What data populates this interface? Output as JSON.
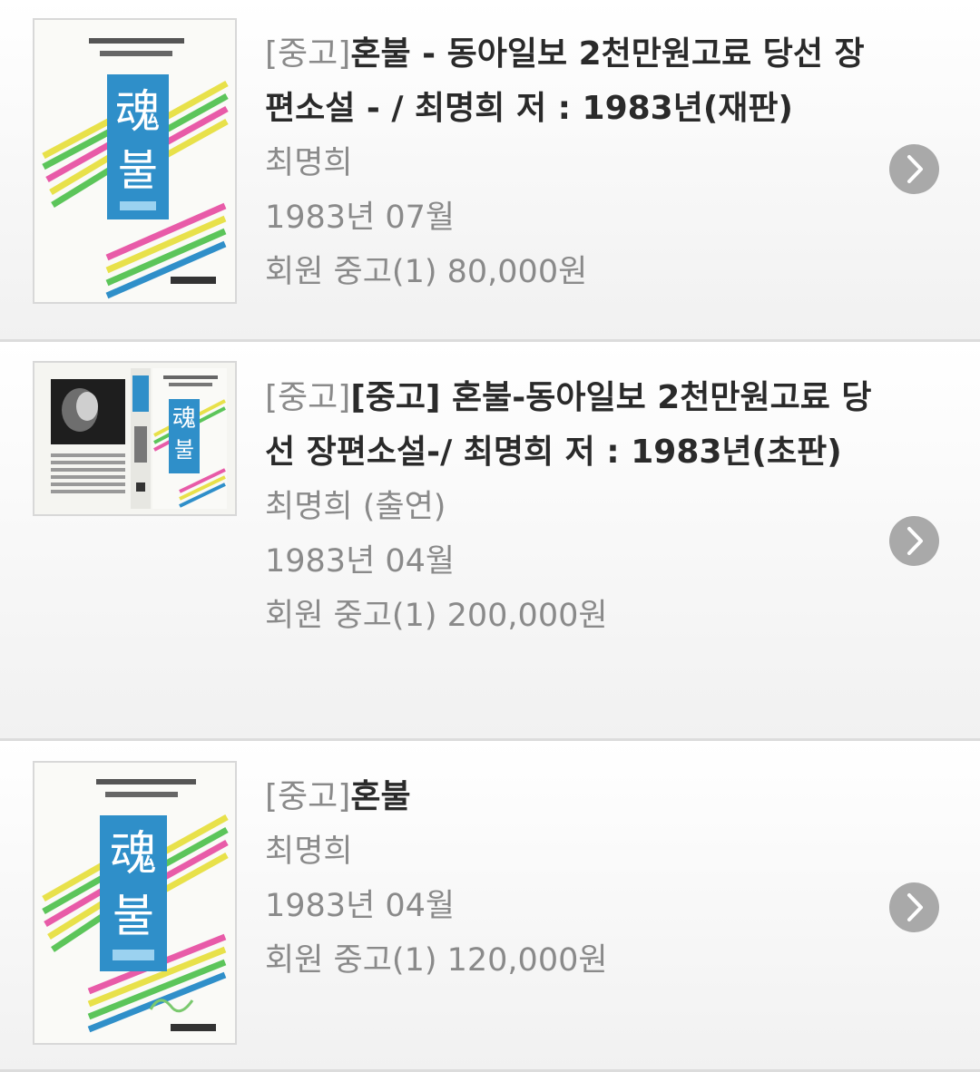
{
  "items": [
    {
      "tag": "[중고]",
      "title": "혼불 - 동아일보 2천만원고료 당선 장편소설 - / 최명희 저 : 1983년(재판)",
      "author": "최명희",
      "date": "1983년 07월",
      "price": "회원 중고(1) 80,000원",
      "cover_title": "魂",
      "cover_title_2": "불",
      "icon": "chevron-right-icon"
    },
    {
      "tag": "[중고]",
      "title": "[중고] 혼불-동아일보 2천만원고료 당선 장편소설-/ 최명희 저 : 1983년(초판)",
      "author": "최명희 (출연)",
      "date": "1983년 04월",
      "price": "회원 중고(1) 200,000원",
      "cover_title": "魂",
      "cover_title_2": "불",
      "icon": "chevron-right-icon"
    },
    {
      "tag": "[중고]",
      "title": "혼불",
      "author": "최명희",
      "date": "1983년 04월",
      "price": "회원 중고(1) 120,000원",
      "cover_title": "魂",
      "cover_title_2": "불",
      "icon": "chevron-right-icon"
    }
  ],
  "colors": {
    "cover_blue": "#2f8fc9",
    "arrow_bg": "#a9a9a9",
    "title_text": "#2a2a2a",
    "meta_text": "#8a8a8a",
    "divider": "#dcdcdc"
  }
}
